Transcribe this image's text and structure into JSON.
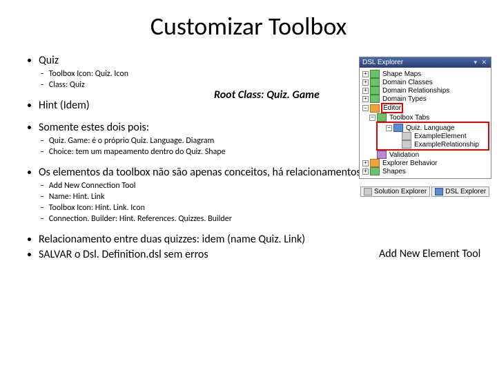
{
  "title": "Customizar Toolbox",
  "bullets": {
    "quiz": {
      "heading": "Quiz",
      "sub1": "Toolbox Icon: Quiz. Icon",
      "sub2": "Class: Quiz"
    },
    "hint": "Hint (Idem)",
    "somente": {
      "heading": "Somente estes dois pois:",
      "sub1": "Quiz. Game: é o próprio Quiz. Language. Diagram",
      "sub2": "Choice: tem um mapeamento dentro do Quiz. Shape"
    },
    "elementos": {
      "heading": "Os elementos da toolbox não são apenas conceitos, há relacionamentos:",
      "sub1": "Add New Connection Tool",
      "sub2": "Name: Hint. Link",
      "sub3": "Toolbox Icon: Hint. Link. Icon",
      "sub4": "Connection. Builder: Hint. References. Quizzes. Builder"
    },
    "relac": "Relacionamento entre duas quizzes: idem (name Quiz. Link)",
    "salvar": "SALVAR o Dsl. Definition.dsl sem erros"
  },
  "annotations": {
    "root_class": "Root Class: Quiz. Game",
    "add_new_tool": "Add New Element Tool"
  },
  "explorer": {
    "title": "DSL Explorer",
    "items": {
      "shape_maps": "Shape Maps",
      "domain_classes": "Domain Classes",
      "domain_relationships": "Domain Relationships",
      "domain_types": "Domain Types",
      "editor": "Editor",
      "toolbox_tabs": "Toolbox Tabs",
      "quiz_language": "Quiz. Language",
      "example_element": "ExampleElement",
      "example_relationship": "ExampleRelationship",
      "validation": "Validation",
      "explorer_behavior": "Explorer Behavior",
      "shapes": "Shapes"
    },
    "tabs": {
      "solution": "Solution Explorer",
      "dsl": "DSL Explorer"
    }
  }
}
